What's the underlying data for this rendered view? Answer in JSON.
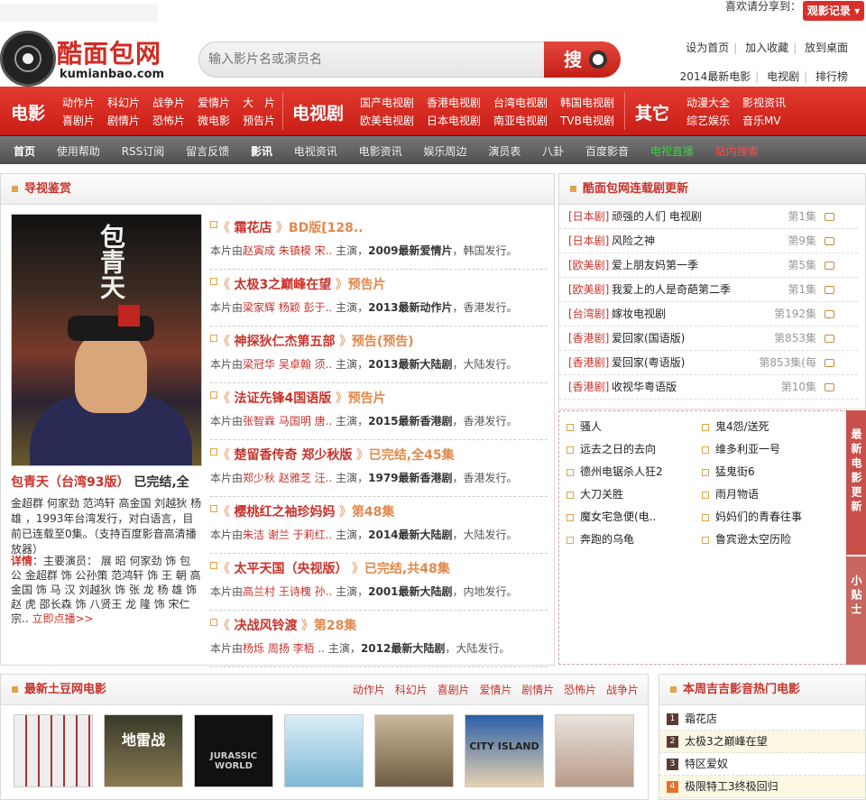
{
  "topbar": {
    "share_text": "喜欢请分享到：",
    "history_button": "观影记录 ▾"
  },
  "header": {
    "logo_title": "酷面包网",
    "logo_domain": "kumianbao.com",
    "search_placeholder": "输入影片名或演员名",
    "search_button": "搜",
    "links_row1": [
      "设为首页",
      "加入收藏",
      "放到桌面"
    ],
    "links_row2": [
      "2014最新电影",
      "电视剧",
      "排行榜"
    ]
  },
  "rednav": {
    "movie_label": "电影",
    "movie_items": [
      "动作片",
      "科幻片",
      "战争片",
      "爱情片",
      "大　片",
      "喜剧片",
      "剧情片",
      "恐怖片",
      "微电影",
      "预告片"
    ],
    "tv_label": "电视剧",
    "tv_items": [
      "国产电视剧",
      "香港电视剧",
      "台湾电视剧",
      "韩国电视剧",
      "欧美电视剧",
      "日本电视剧",
      "南亚电视剧",
      "TVB电视剧"
    ],
    "other_label": "其它",
    "other_items": [
      "动漫大全",
      "影视资讯",
      "综艺娱乐",
      "音乐MV"
    ]
  },
  "graynav": {
    "items": [
      "首页",
      "使用帮助",
      "RSS订阅",
      "留言反馈",
      "影讯",
      "电视资讯",
      "电影资讯",
      "娱乐周边",
      "演员表",
      "八卦",
      "百度影音",
      "电视直播",
      "站内搜索"
    ]
  },
  "guide": {
    "header": "导视鉴赏",
    "featured": {
      "title": "包青天（台湾93版）",
      "status": "已完结,全",
      "poster_text": "包青天",
      "desc": "金超群 何家劲 范鸿轩 高金国 刘越狄 杨雄 ，1993年台湾发行，对白语言，目前已连载至0集。（支持百度影音高清播放器）",
      "cast_label": "详情",
      "cast": "：主要演员： 展 昭 何家劲 饰 包 公 金超群 饰 公孙策 范鸿轩 饰 王 朝 高金国 饰 马 汉 刘越狄 饰 张 龙 杨 雄 饰 赵 虎 邵长森 饰 八贤王 龙 隆 饰 宋仁宗..",
      "play_link": "立即点播>>"
    },
    "items": [
      {
        "title": "霜花店",
        "tag": "BD版[128..",
        "actors": "赵寅成 朱镇模 宋..",
        "year": "2009最新爱情片",
        "place": "韩国发行。"
      },
      {
        "title": "太极3之巅峰在望",
        "tag": "预告片",
        "actors": "梁家辉 杨颖 彭于..",
        "year": "2013最新动作片",
        "place": "香港发行。"
      },
      {
        "title": "神探狄仁杰第五部",
        "tag": "预告(预告)",
        "actors": "梁冠华 吴卓翰 须..",
        "year": "2013最新大陆剧",
        "place": "大陆发行。"
      },
      {
        "title": "法证先锋4国语版",
        "tag": "预告片",
        "actors": "张智霖 马国明 唐..",
        "year": "2015最新香港剧",
        "place": "香港发行。"
      },
      {
        "title": "楚留香传奇 郑少秋版",
        "tag": "已完结,全45集",
        "actors": "郑少秋 赵雅芝 汪..",
        "year": "1979最新香港剧",
        "place": "香港发行。"
      },
      {
        "title": "樱桃红之袖珍妈妈",
        "tag": "第48集",
        "actors": "朱洁 谢兰 于莉红..",
        "year": "2014最新大陆剧",
        "place": "大陆发行。"
      },
      {
        "title": "太平天国（央视版）",
        "tag": "已完结,共48集",
        "actors": "高兰村 王诗槐 孙..",
        "year": "2001最新大陆剧",
        "place": "内地发行。"
      },
      {
        "title": "决战风铃渡",
        "tag": "第28集",
        "actors": "杨烁 周扬 李栢 ..",
        "year": "2012最新大陆剧",
        "place": "大陆发行。"
      }
    ],
    "pre_text": "本片由",
    "mid_text": "主演，",
    "sep_text": "，"
  },
  "series": {
    "header": "酷面包网连载剧更新",
    "rows": [
      {
        "region": "[日本剧]",
        "name": "顽强的人们 电视剧",
        "ep": "第1集"
      },
      {
        "region": "[日本剧]",
        "name": "风险之神",
        "ep": "第9集"
      },
      {
        "region": "[欧美剧]",
        "name": "爱上朋友妈第一季",
        "ep": "第5集"
      },
      {
        "region": "[欧美剧]",
        "name": "我爱上的人是奇葩第二季",
        "ep": "第1集"
      },
      {
        "region": "[台湾剧]",
        "name": "嫁妆电视剧",
        "ep": "第192集"
      },
      {
        "region": "[香港剧]",
        "name": "爱回家(国语版)",
        "ep": "第853集"
      },
      {
        "region": "[香港剧]",
        "name": "爱回家(粤语版)",
        "ep": "第853集(每"
      },
      {
        "region": "[香港剧]",
        "name": "收视华粤语版",
        "ep": "第10集"
      }
    ]
  },
  "new_movies": {
    "items": [
      "骚人",
      "鬼4怨/送死",
      "远去之日的去向",
      "维多利亚一号",
      "德州电锯杀人狂2",
      "猛鬼街6",
      "大刀关胜",
      "雨月物语",
      "魔女宅急便(电..",
      "妈妈们的青春往事",
      "奔跑的乌龟",
      "鲁宾逊太空历险"
    ],
    "tab1": "最新电影更新",
    "tab2": "小贴士"
  },
  "tudou": {
    "header": "最新土豆网电影",
    "tabs": [
      "动作片",
      "科幻片",
      "喜剧片",
      "爱情片",
      "剧情片",
      "恐怖片",
      "战争片"
    ],
    "thumbs": [
      "",
      "地雷战",
      "JURASSIC WORLD",
      "",
      "",
      "CITY ISLAND",
      ""
    ]
  },
  "hot": {
    "header": "本周吉吉影音热门电影",
    "items": [
      {
        "n": "1",
        "name": "霜花店"
      },
      {
        "n": "2",
        "name": "太极3之巅峰在望"
      },
      {
        "n": "3",
        "name": "特区爱奴"
      },
      {
        "n": "4",
        "name": "极限特工3终极回归"
      }
    ]
  },
  "colors": {
    "brand_red": "#d42a22",
    "nav_gray": "#5a5a5a",
    "accent_orange": "#e0894d",
    "live_green": "#3fcf3f",
    "search_red": "#ff4b4b"
  }
}
